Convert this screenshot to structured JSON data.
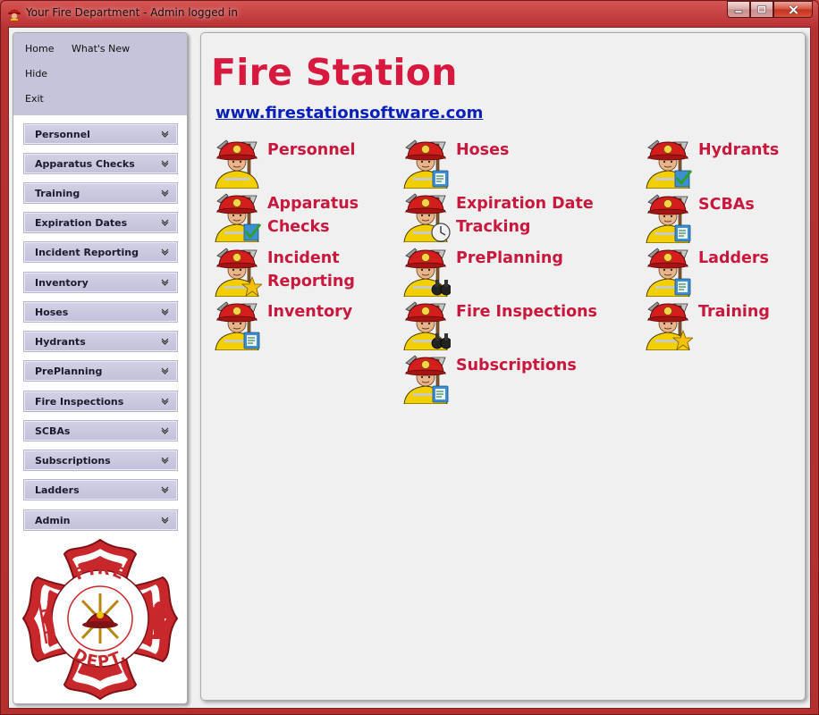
{
  "window": {
    "title": "Your Fire Department - Admin logged in",
    "accent": "#b83131"
  },
  "sidebar": {
    "top_links": [
      "Home",
      "What's New",
      "Hide",
      "Exit"
    ],
    "items": [
      {
        "label": "Personnel"
      },
      {
        "label": "Apparatus Checks"
      },
      {
        "label": "Training"
      },
      {
        "label": "Expiration Dates"
      },
      {
        "label": "Incident Reporting"
      },
      {
        "label": "Inventory"
      },
      {
        "label": "Hoses"
      },
      {
        "label": "Hydrants"
      },
      {
        "label": "PrePlanning"
      },
      {
        "label": "Fire Inspections"
      },
      {
        "label": "SCBAs"
      },
      {
        "label": "Subscriptions"
      },
      {
        "label": "Ladders"
      },
      {
        "label": "Admin"
      }
    ],
    "badge": {
      "top_text": "FIRE",
      "bottom_text": "DEPT."
    }
  },
  "main": {
    "title": "Fire Station",
    "link": "www.firestationsoftware.com",
    "title_color": "#d7193f",
    "tiles": [
      {
        "label": "Personnel",
        "badge": "none"
      },
      {
        "label": "Apparatus Checks",
        "badge": "check"
      },
      {
        "label": "Incident Reporting",
        "badge": "star"
      },
      {
        "label": "Inventory",
        "badge": "clipboard"
      },
      {
        "label": "Hoses",
        "badge": "clipboard"
      },
      {
        "label": "Expiration Date Tracking",
        "badge": "clock"
      },
      {
        "label": "PrePlanning",
        "badge": "binoculars"
      },
      {
        "label": "Fire Inspections",
        "badge": "binoculars"
      },
      {
        "label": "Subscriptions",
        "badge": "clipboard"
      },
      {
        "label": "Hydrants",
        "badge": "check"
      },
      {
        "label": "SCBAs",
        "badge": "clipboard"
      },
      {
        "label": "Ladders",
        "badge": "clipboard"
      },
      {
        "label": "Training",
        "badge": "star"
      }
    ]
  }
}
